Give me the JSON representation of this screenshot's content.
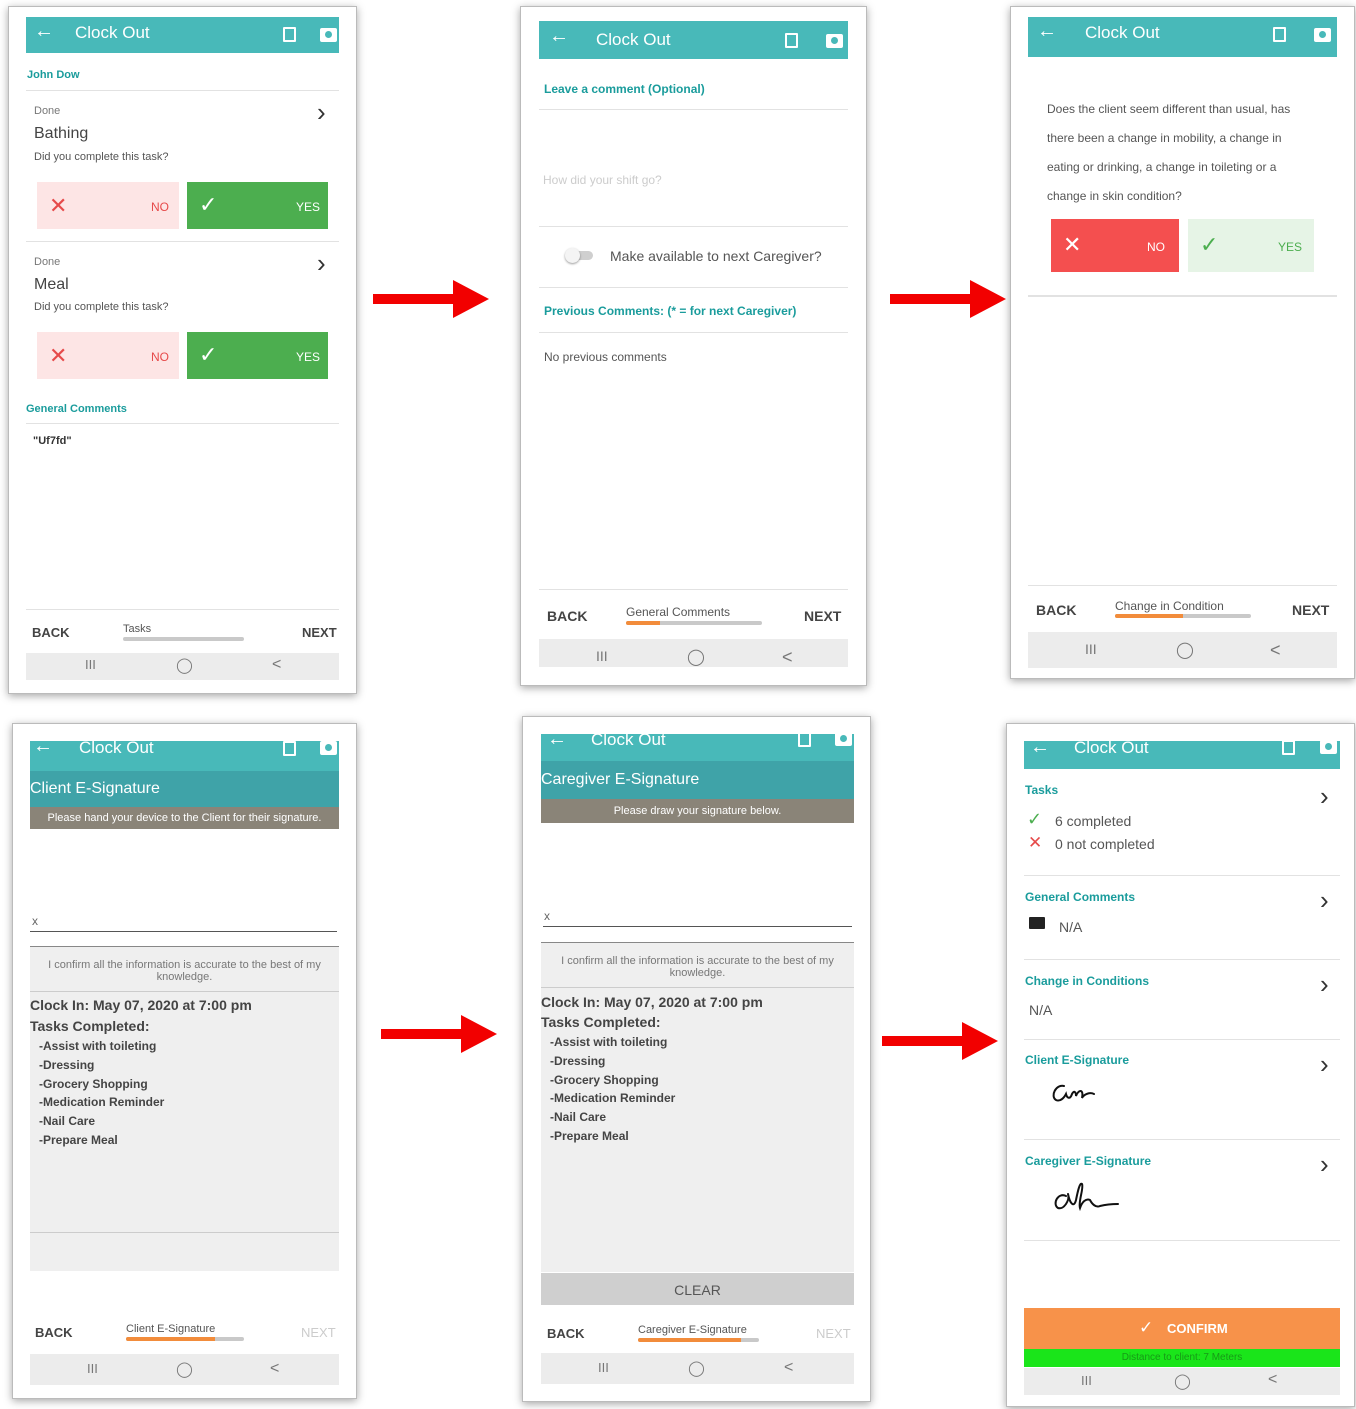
{
  "common": {
    "back_icon": "←",
    "header_title": "Clock Out",
    "back": "BACK",
    "next": "NEXT",
    "nav_recent": "III",
    "nav_home": "◯",
    "nav_back": "<",
    "no": "NO",
    "yes": "YES",
    "x_glyph": "✕",
    "check_glyph": "✓",
    "chevron": "›"
  },
  "screen1": {
    "client_name": "John Dow",
    "tasks": [
      {
        "status": "Done",
        "name": "Bathing",
        "question": "Did you complete this task?"
      },
      {
        "status": "Done",
        "name": "Meal",
        "question": "Did you complete this task?"
      }
    ],
    "general_comments_label": "General Comments",
    "comment_value": "\"Uf7fd\"",
    "footer_label": "Tasks",
    "progress": 0
  },
  "screen2": {
    "leave_comment_label": "Leave a comment (Optional)",
    "comment_placeholder": "How did your shift go?",
    "toggle_label": "Make available to next Caregiver?",
    "toggle_on": false,
    "previous_comments_label": "Previous Comments: (* = for next Caregiver)",
    "no_previous": "No previous comments",
    "footer_label": "General Comments",
    "progress": 0.25
  },
  "screen3": {
    "question": "Does the client seem different than usual, has there been a change in mobility, a change in eating or drinking, a change in toileting or a change in skin condition?",
    "footer_label": "Change in Condition",
    "progress": 0.5
  },
  "sig_common": {
    "x_mark": "x",
    "confirm_text": "I confirm all the information is accurate to the best of my knowledge.",
    "clock_in": "Clock In: May 07, 2020 at 7:00 pm",
    "tasks_completed_label": "Tasks Completed:",
    "tasks_list": [
      "-Assist with toileting",
      "-Dressing",
      "-Grocery Shopping",
      "-Medication Reminder",
      "-Nail Care",
      "-Prepare Meal"
    ]
  },
  "screen4": {
    "header": "Client E-Signature",
    "sub": "Please hand your device to the Client for their signature.",
    "footer_label": "Client E-Signature",
    "progress": 0.75
  },
  "screen5": {
    "header": "Caregiver E-Signature",
    "sub": "Please draw your signature below.",
    "clear": "CLEAR",
    "footer_label": "Caregiver E-Signature",
    "progress": 0.85
  },
  "screen6": {
    "tasks_label": "Tasks",
    "completed": "6 completed",
    "not_completed": "0 not completed",
    "general_comments_label": "General Comments",
    "general_comments_value": "N/A",
    "change_label": "Change in Conditions",
    "change_value": "N/A",
    "client_sig_label": "Client E-Signature",
    "caregiver_sig_label": "Caregiver E-Signature",
    "confirm": "CONFIRM",
    "distance": "Distance to client: 7 Meters"
  },
  "colors": {
    "teal_header": "#48b9b9",
    "teal_text": "#1a9c9c",
    "yes_green": "#4cae4f",
    "no_red": "#f44f4f",
    "confirm_orange": "#f7924a",
    "distance_green": "#1ae51a",
    "arrow_red": "#f20000"
  }
}
